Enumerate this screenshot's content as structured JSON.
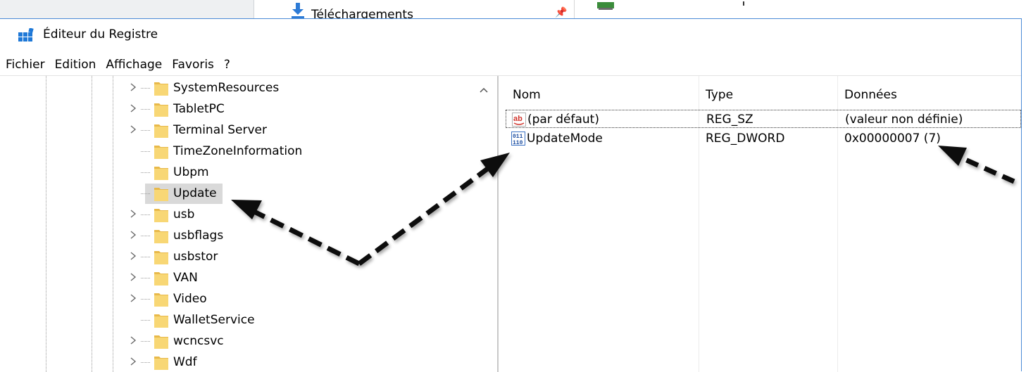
{
  "background": {
    "quick_access_label": "Téléchargements"
  },
  "window": {
    "title": "Éditeur du Registre"
  },
  "menu": [
    "Fichier",
    "Edition",
    "Affichage",
    "Favoris",
    "?"
  ],
  "tree": {
    "items": [
      {
        "label": "SystemResources",
        "expandable": true
      },
      {
        "label": "TabletPC",
        "expandable": true
      },
      {
        "label": "Terminal Server",
        "expandable": true
      },
      {
        "label": "TimeZoneInformation",
        "expandable": false
      },
      {
        "label": "Ubpm",
        "expandable": false
      },
      {
        "label": "Update",
        "expandable": false,
        "selected": true
      },
      {
        "label": "usb",
        "expandable": true
      },
      {
        "label": "usbflags",
        "expandable": true
      },
      {
        "label": "usbstor",
        "expandable": true
      },
      {
        "label": "VAN",
        "expandable": true
      },
      {
        "label": "Video",
        "expandable": true
      },
      {
        "label": "WalletService",
        "expandable": false
      },
      {
        "label": "wcncsvc",
        "expandable": true
      },
      {
        "label": "Wdf",
        "expandable": true
      }
    ]
  },
  "list": {
    "columns": [
      "Nom",
      "Type",
      "Données"
    ],
    "rows": [
      {
        "icon": "string-value-icon",
        "name": "(par défaut)",
        "type": "REG_SZ",
        "data": "(valeur non définie)"
      },
      {
        "icon": "binary-value-icon",
        "name": "UpdateMode",
        "type": "REG_DWORD",
        "data": "0x00000007 (7)"
      }
    ]
  },
  "colors": {
    "selection": "#d9d9d9",
    "folder": "#f8d775",
    "window_border": "#4a8ad6"
  }
}
